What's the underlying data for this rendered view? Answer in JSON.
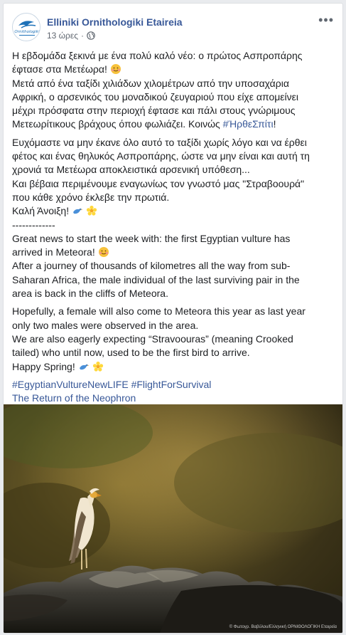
{
  "post": {
    "page_name": "Elliniki Ornithologiki Etaireia",
    "timestamp": "13 ώρες",
    "separator": "·",
    "more_label": "•••",
    "avatar_text": "Ornithologiki",
    "greek": {
      "line1": "Η εβδομάδα ξεκινά με ένα πολύ καλό νέο: ο πρώτος Ασπροπάρης",
      "line2": "έφτασε στα Μετέωρα!",
      "line3": "Μετά από ένα ταξίδι χιλιάδων χιλομέτρων από την υποσαχάρια",
      "line4": "Αφρική, ο αρσενικός του μοναδικού ζευγαριού που είχε απομείνει",
      "line5": "μέχρι πρόσφατα στην περιοχή έφτασε και πάλι στους γνώριμους",
      "line6": "Μετεωρίτικους βράχους όπου φωλιάζει. Κοινώς",
      "hashtag": "#ΉρθεΣπίτι",
      "hashtag_after": "!",
      "line7": "Ευχόμαστε να μην έκανε όλο αυτό το ταξίδι χωρίς λόγο και να έρθει",
      "line8": "φέτος και ένας θηλυκός Ασπροπάρης, ώστε να μην είναι και αυτή τη",
      "line9": "χρονιά τα Μετέωρα αποκλειστικά αρσενική υπόθεση...",
      "line10": "Και βέβαια περιμένουμε εναγωνίως τον γνωστό μας \"Στραβοουρά\"",
      "line11": "που κάθε χρόνο έκλεβε την πρωτιά.",
      "line12": "Καλή Άνοιξη!"
    },
    "divider": "-------------",
    "english": {
      "line1": "Great news to start the week with: the first Egyptian vulture has",
      "line2": "arrived in Meteora!",
      "line3": "After a journey of thousands of kilometres all the way from sub-",
      "line4": "Saharan Africa, the male individual of the last surviving pair in the",
      "line5": "area is back in the cliffs of Meteora.",
      "line6": "Hopefully, a female will also come to Meteora this year as last year",
      "line7": "only two males were observed in the area.",
      "line8": "We are also eagerly expecting “Stravoouras” (meaning Crooked",
      "line9": "tailed) who until now, used to be the first bird to arrive.",
      "line10": "Happy Spring!"
    },
    "hashtags": "#EgyptianVultureNewLIFE #FlightForSurvival",
    "link_text": "The Return of the Neophron",
    "photo_credit": "© Φωτογρ. Βαβύλου/Ελληνική ΟΡΝΙΘΟΛΟΓΙΚΗ Εταιρεία"
  },
  "colors": {
    "link": "#385898",
    "text": "#1c1e21",
    "meta": "#606770",
    "background": "#e9ebee"
  },
  "icons": [
    "globe-icon",
    "more-icon",
    "hugging-face-emoji",
    "bird-emoji",
    "blossom-emoji"
  ]
}
